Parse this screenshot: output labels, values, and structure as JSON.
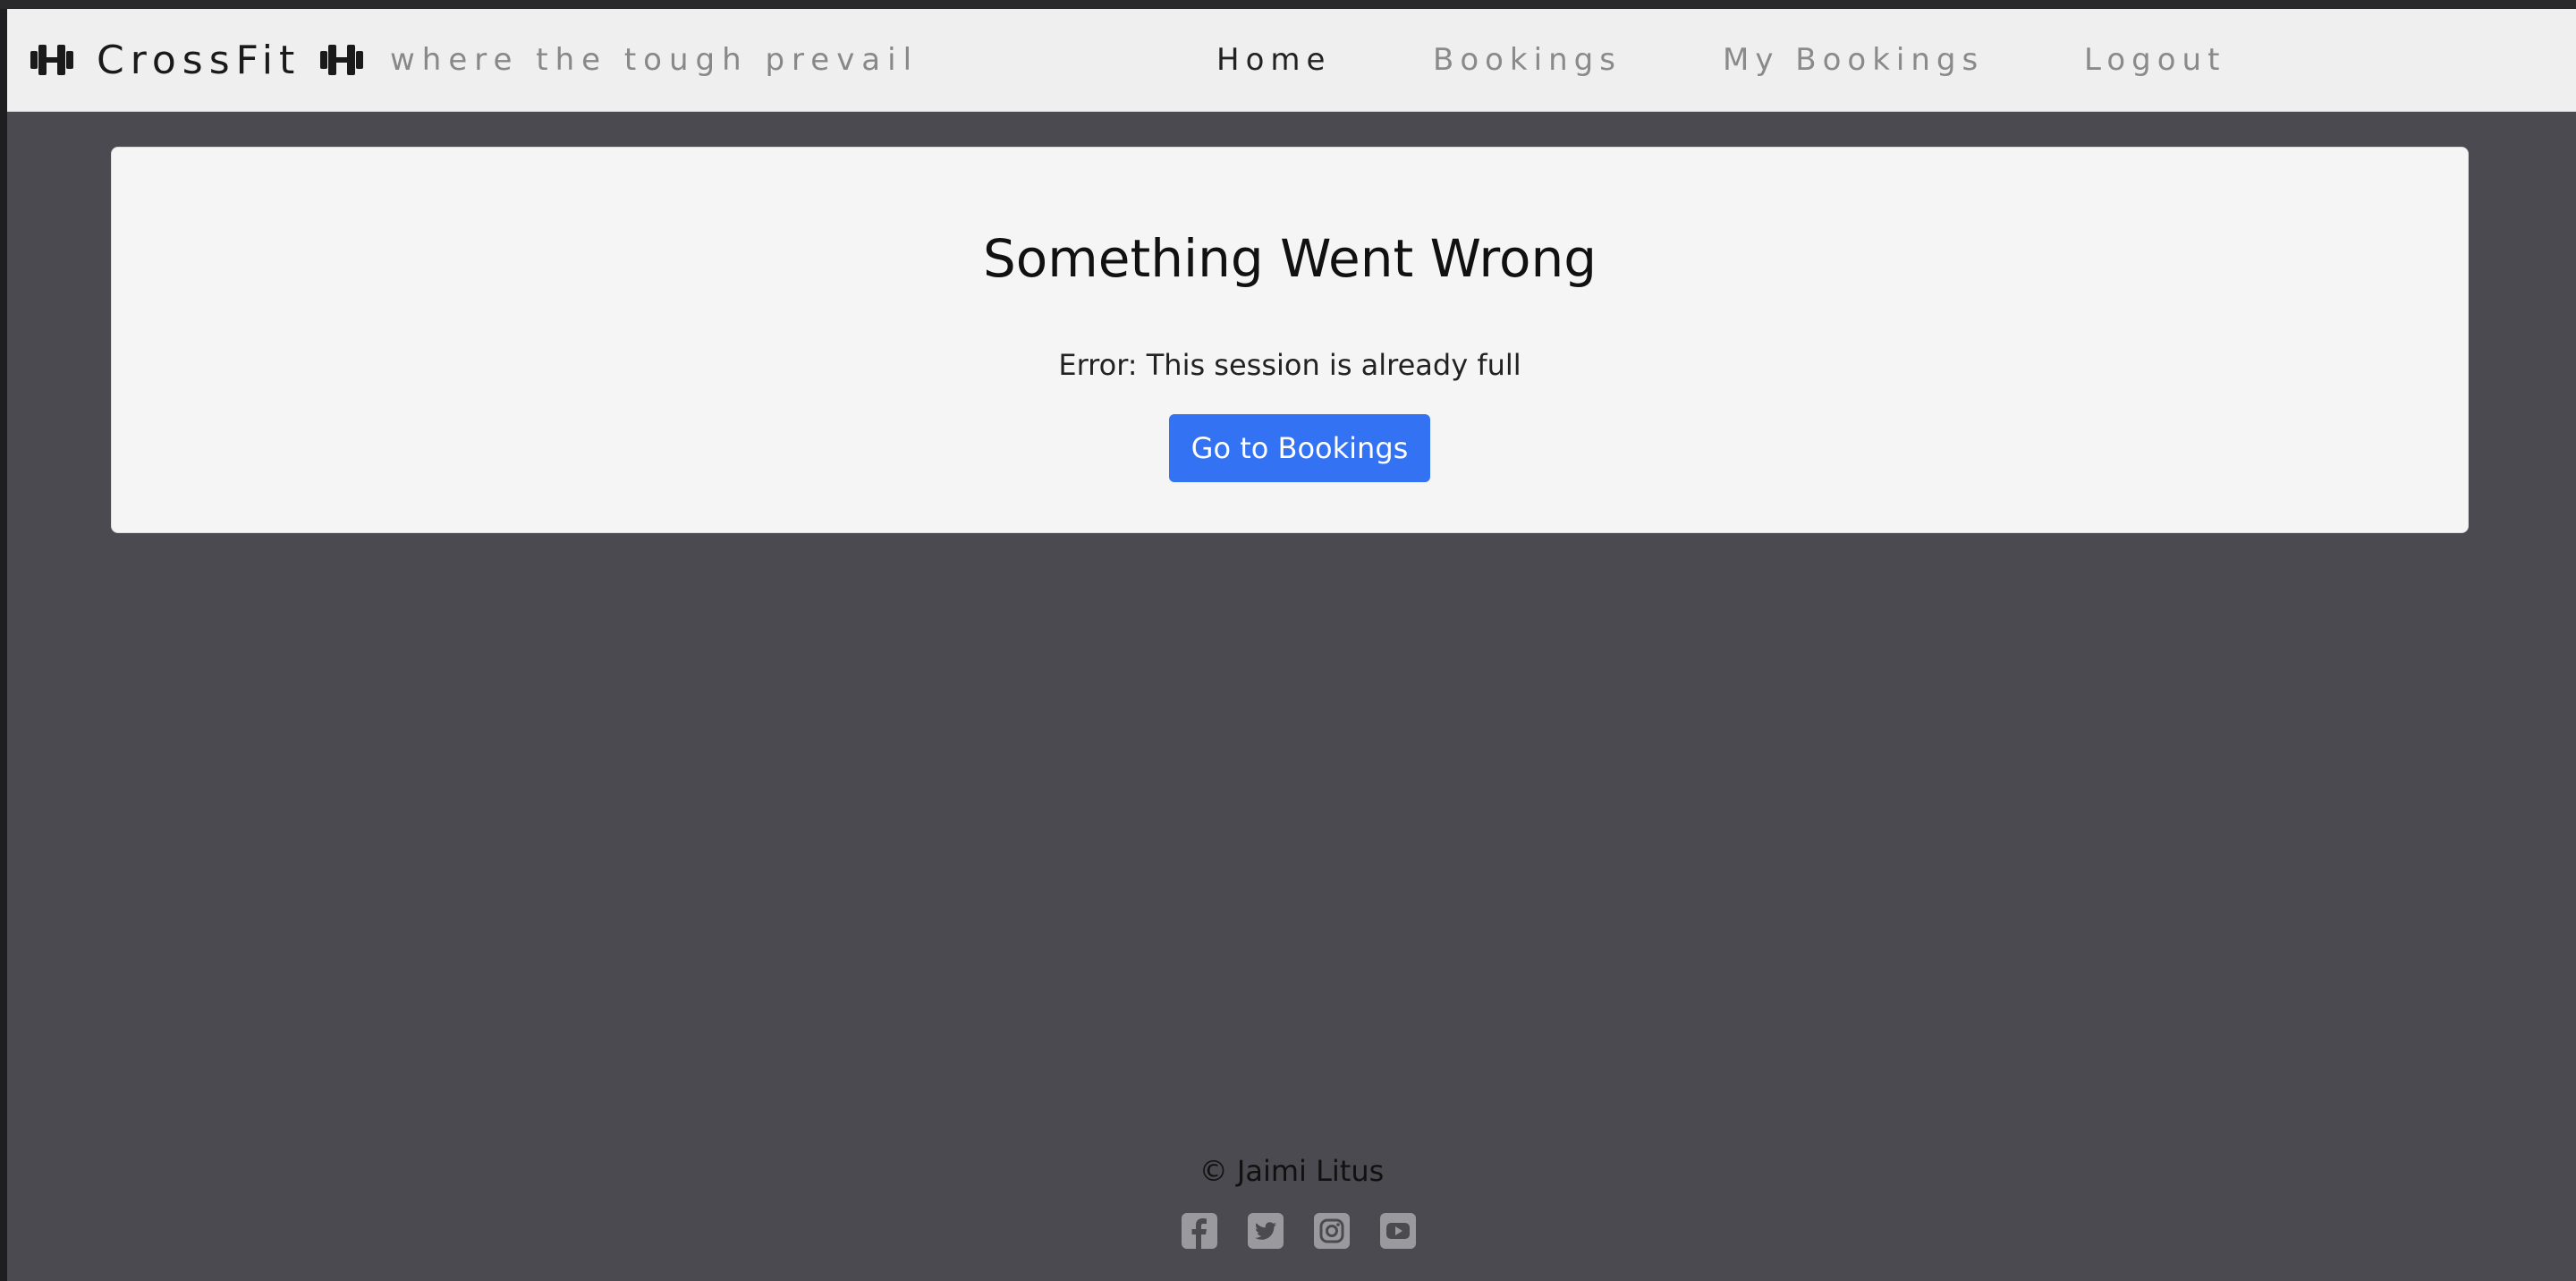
{
  "header": {
    "brand": "CrossFit",
    "tagline": "where the tough prevail",
    "nav": [
      {
        "label": "Home",
        "active": true
      },
      {
        "label": "Bookings",
        "active": false
      },
      {
        "label": "My Bookings",
        "active": false
      },
      {
        "label": "Logout",
        "active": false
      }
    ],
    "brand_icon": "dumbbell-icon"
  },
  "error_card": {
    "title": "Something Went Wrong",
    "message": "Error: This session is already full",
    "button_label": "Go to Bookings"
  },
  "footer": {
    "copyright": "© Jaimi Litus",
    "social_icons": [
      "facebook-icon",
      "twitter-icon",
      "instagram-icon",
      "youtube-icon"
    ]
  },
  "colors": {
    "background": "#4b4a50",
    "navbar": "#efefef",
    "card": "#f5f5f5",
    "button": "#3372f2",
    "social_icon": "#9a9a9e"
  }
}
